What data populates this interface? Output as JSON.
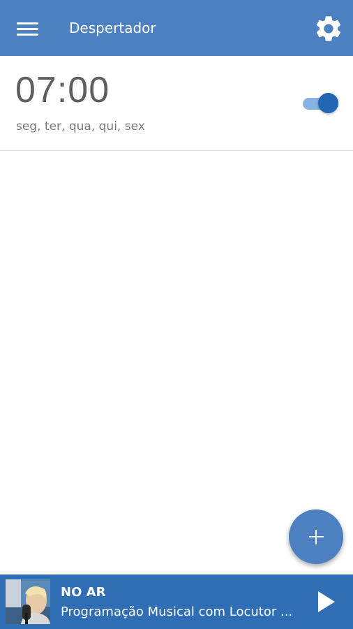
{
  "header": {
    "title": "Despertador",
    "menu_icon": "hamburger-menu-icon",
    "settings_icon": "gear-icon"
  },
  "alarms": [
    {
      "time": "07:00",
      "days": "seg, ter, qua, qui, sex",
      "enabled": true
    }
  ],
  "fab": {
    "icon": "plus-icon"
  },
  "player": {
    "status": "NO AR",
    "program": "Programação Musical com Locutor ...",
    "play_icon": "play-icon"
  },
  "colors": {
    "primary": "#4d80c0",
    "player_bg": "#2f6db5",
    "toggle_on": "#2266b3",
    "toggle_track": "#86b3e2"
  }
}
